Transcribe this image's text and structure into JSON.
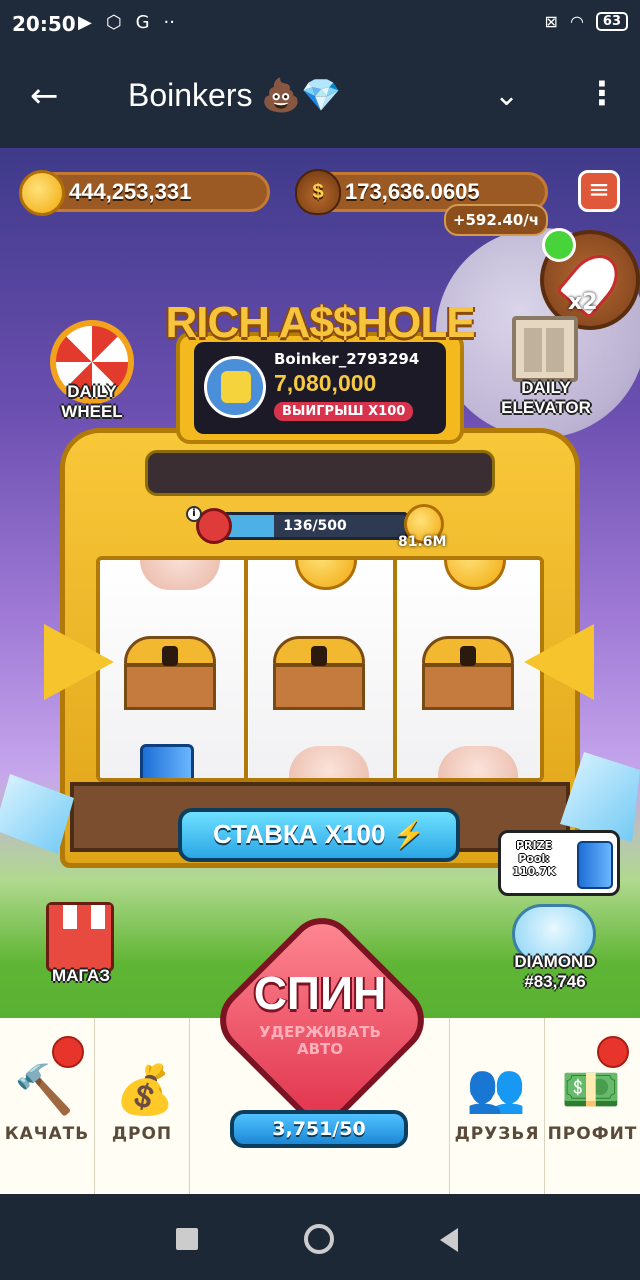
{
  "status_bar": {
    "time": "20:50",
    "icons_left": [
      "youtube-icon",
      "mi-icon",
      "g-icon",
      "dots-icon"
    ],
    "icons_right": [
      "sim-icon",
      "wifi-icon",
      "battery-icon"
    ],
    "battery_level": "63"
  },
  "app_header": {
    "title": "Boinkers 💩💎",
    "back_icon": "arrow-left-icon",
    "collapse_icon": "chevron-down-icon",
    "more_icon": "more-vert-icon"
  },
  "balances": {
    "coins": "444,253,331",
    "poop_dollars": "173,636.0605",
    "rate": "+592.40/ч"
  },
  "left_shortcuts": {
    "daily_wheel": "DAILY\nWHEEL",
    "shop": "МАГАЗ"
  },
  "right_shortcuts": {
    "rocket_multiplier": "x2",
    "daily_elevator": "DAILY\nELEVATOR",
    "prize_pool": "PRIZE\nPool:\n110.7K",
    "diamond": "DIAMOND\n#83,746"
  },
  "banner": {
    "logo": "RICH A$$HOLE",
    "winner_name": "Boinker_2793294",
    "winner_amount": "7,080,000",
    "winner_badge": "ВЫИГРЫШ X100"
  },
  "slot": {
    "progress_text": "136/500",
    "progress_fraction": 0.272,
    "prize": "81.6M",
    "bet_button": "СТАВКА X100 ⚡"
  },
  "spin": {
    "label": "СПИН",
    "hint": "УДЕРЖИВАТЬ\nАВТО",
    "spins_count": "3,751/50"
  },
  "bottom_nav": [
    {
      "label": "КАЧАТЬ",
      "icon": "hammer-icon",
      "badge": true
    },
    {
      "label": "ДРОП",
      "icon": "bag-icon",
      "badge": false
    },
    {
      "label": "ДРУЗЬЯ",
      "icon": "friends-icon",
      "badge": false
    },
    {
      "label": "ПРОФИТ",
      "icon": "money-icon",
      "badge": true
    }
  ],
  "colors": {
    "header_bg": "#1f2b3a",
    "spin_red": "#e0314a",
    "bet_blue": "#2aa6e5",
    "gold": "#f3b91e"
  }
}
